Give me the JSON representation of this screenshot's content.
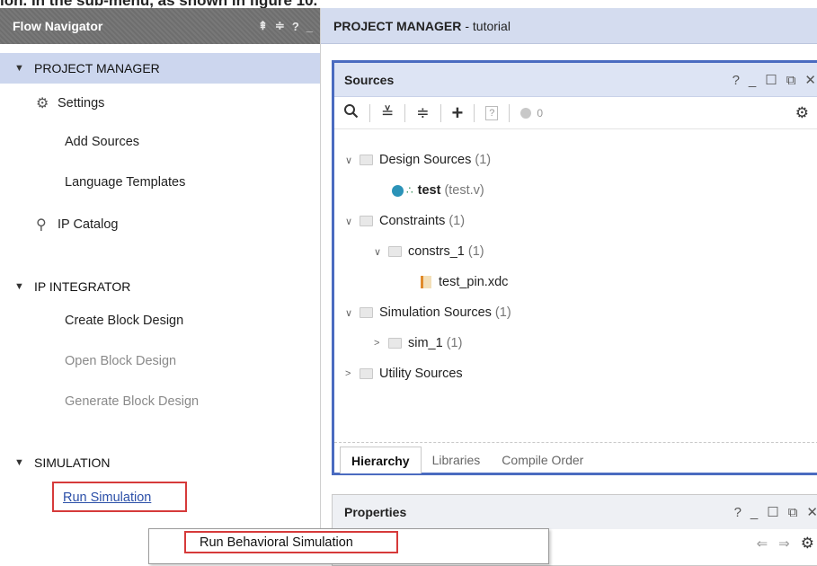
{
  "caption": {
    "visible_text": "ion. In the sub-menu, as shown in figure 10."
  },
  "flow_navigator": {
    "title": "Flow Navigator",
    "tools": {
      "collapse_all": "⇞",
      "expand": "≑",
      "help": "?",
      "minimize": "_"
    },
    "sections": [
      {
        "title": "PROJECT MANAGER",
        "active": true,
        "items": [
          {
            "label": "Settings",
            "icon": "gear-icon"
          },
          {
            "label": "Add Sources"
          },
          {
            "label": "Language Templates"
          },
          {
            "label": "IP Catalog",
            "icon": "ip-plug-icon"
          }
        ]
      },
      {
        "title": "IP INTEGRATOR",
        "items": [
          {
            "label": "Create Block Design"
          },
          {
            "label": "Open Block Design",
            "disabled": true
          },
          {
            "label": "Generate Block Design",
            "disabled": true
          }
        ]
      },
      {
        "title": "SIMULATION",
        "items": [
          {
            "label": "Run Simulation",
            "highlighted": true
          }
        ]
      }
    ]
  },
  "project_manager": {
    "label": "PROJECT MANAGER",
    "project": "- tutorial"
  },
  "sources_panel": {
    "title": "Sources",
    "controls": {
      "help": "?",
      "minimize": "_",
      "maximize": "☐",
      "float": "⧉",
      "close": "✕"
    },
    "toolbar": {
      "search": "🔍",
      "collapse": "≚",
      "expand": "≑",
      "add": "+",
      "question": "?",
      "count": "0"
    },
    "tree": [
      {
        "label": "Design Sources",
        "count": "(1)"
      },
      {
        "label": "test",
        "detail": "(test.v)"
      },
      {
        "label": "Constraints",
        "count": "(1)"
      },
      {
        "label": "constrs_1",
        "count": "(1)"
      },
      {
        "label": "test_pin.xdc"
      },
      {
        "label": "Simulation Sources",
        "count": "(1)"
      },
      {
        "label": "sim_1",
        "count": "(1)"
      },
      {
        "label": "Utility Sources"
      }
    ],
    "tabs": [
      {
        "label": "Hierarchy",
        "active": true
      },
      {
        "label": "Libraries"
      },
      {
        "label": "Compile Order"
      }
    ]
  },
  "properties_panel": {
    "title": "Properties",
    "controls": {
      "help": "?",
      "minimize": "_",
      "maximize": "☐",
      "float": "⧉",
      "close": "✕"
    },
    "toolbar": {
      "back": "⇐",
      "forward": "⇒"
    }
  },
  "context_menu": {
    "items": [
      {
        "label": "Run Behavioral Simulation",
        "highlighted": true
      }
    ]
  },
  "colors": {
    "accent_blue": "#4a6bc0",
    "highlight_red": "#d63a3a",
    "section_active_bg": "#ccd6ee"
  }
}
